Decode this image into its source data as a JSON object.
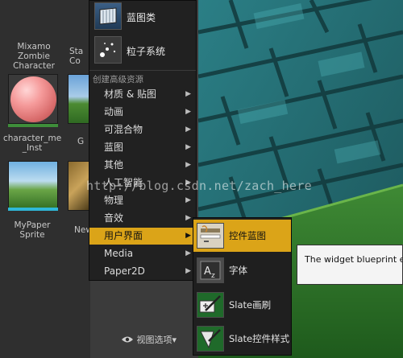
{
  "assets": [
    {
      "label": "Mixamo\nZombie\nCharacter"
    },
    {
      "label": "Sta\nCo"
    },
    {
      "label": "character_me\n_Inst"
    },
    {
      "label": "G"
    },
    {
      "label": "MyPaper\nSprite"
    },
    {
      "label": "New"
    }
  ],
  "menu": {
    "top_items": [
      {
        "label": "蓝图类",
        "icon": "blueprint-class-icon"
      },
      {
        "label": "粒子系统",
        "icon": "particle-system-icon"
      }
    ],
    "section_header": "创建高级资源",
    "items": [
      {
        "label": "材质 & 贴图",
        "submenu": true
      },
      {
        "label": "动画",
        "submenu": true
      },
      {
        "label": "可混合物",
        "submenu": true
      },
      {
        "label": "蓝图",
        "submenu": true
      },
      {
        "label": "其他",
        "submenu": true
      },
      {
        "label": "人工智能",
        "submenu": true
      },
      {
        "label": "物理",
        "submenu": true
      },
      {
        "label": "音效",
        "submenu": true
      },
      {
        "label": "用户界面",
        "submenu": true,
        "active": true
      },
      {
        "label": "Media",
        "submenu": true
      },
      {
        "label": "Paper2D",
        "submenu": true
      }
    ],
    "arrow_glyph": "▶",
    "footer": "视图选项",
    "footer_caret": "▾"
  },
  "submenu": {
    "items": [
      {
        "label": "控件蓝图",
        "icon": "widget-blueprint-icon",
        "active": true
      },
      {
        "label": "字体",
        "icon": "font-icon"
      },
      {
        "label": "Slate画刷",
        "icon": "slate-brush-icon"
      },
      {
        "label": "Slate控件样式",
        "icon": "slate-widget-style-icon"
      }
    ]
  },
  "tooltip": "The widget blueprint enables",
  "watermark": "http://blog.csdn.net/zach_here",
  "colors": {
    "accent": "#dba418",
    "menu_bg": "#212121",
    "scene": "#1c5f63"
  }
}
